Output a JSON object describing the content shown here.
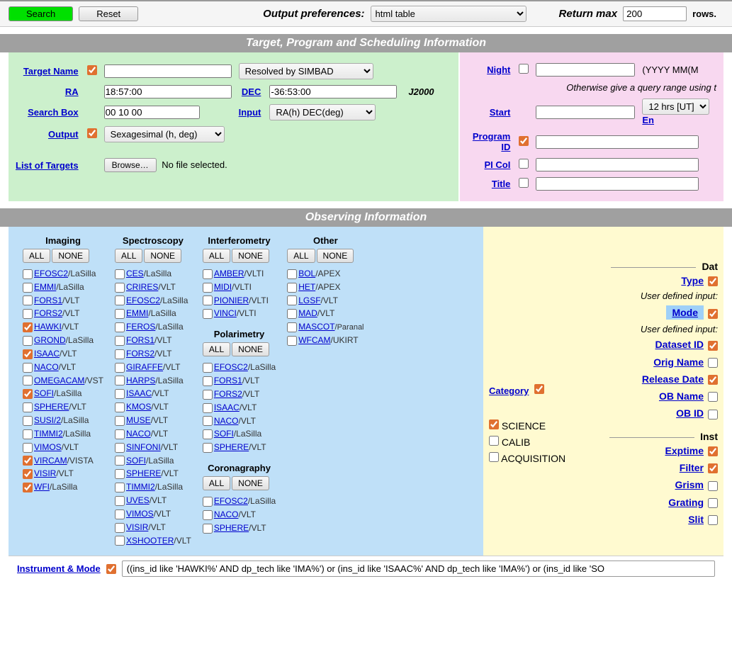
{
  "toolbar": {
    "search": "Search",
    "reset": "Reset",
    "output_pref_label": "Output preferences:",
    "output_pref_value": "html table",
    "return_max_label": "Return max",
    "return_max_value": "200",
    "rows_label": "rows."
  },
  "section1": "Target, Program and Scheduling Information",
  "target": {
    "target_name": "Target Name",
    "resolved_by": "Resolved by SIMBAD",
    "ra_label": "RA",
    "ra_value": "18:57:00",
    "dec_label": "DEC",
    "dec_value": "-36:53:00",
    "j2000": "J2000",
    "search_box": "Search Box",
    "search_box_value": "00 10 00",
    "input_label": "Input",
    "input_value": "RA(h) DEC(deg)",
    "output_label": "Output",
    "output_value": "Sexagesimal (h, deg)",
    "list_of_targets": "List of Targets",
    "browse": "Browse…",
    "no_file": "No file selected."
  },
  "sched": {
    "night": "Night",
    "night_hint": "(YYYY MM(M",
    "otherwise": "Otherwise give a query range using t",
    "start": "Start",
    "start_sel": "12 hrs [UT]",
    "end": "En",
    "program_id": "Program ID",
    "pi_coi": "PI CoI",
    "title": "Title"
  },
  "section2": "Observing Information",
  "inst_groups": {
    "imaging": {
      "title": "Imaging",
      "items": [
        {
          "name": "EFOSC2",
          "obs": "/LaSilla",
          "c": false
        },
        {
          "name": "EMMI",
          "obs": "/LaSilla",
          "c": false
        },
        {
          "name": "FORS1",
          "obs": "/VLT",
          "c": false
        },
        {
          "name": "FORS2",
          "obs": "/VLT",
          "c": false
        },
        {
          "name": "HAWKI",
          "obs": "/VLT",
          "c": true
        },
        {
          "name": "GROND",
          "obs": "/LaSilla",
          "c": false
        },
        {
          "name": "ISAAC",
          "obs": "/VLT",
          "c": true
        },
        {
          "name": "NACO",
          "obs": "/VLT",
          "c": false
        },
        {
          "name": "OMEGACAM",
          "obs": "/VST",
          "c": false
        },
        {
          "name": "SOFI",
          "obs": "/LaSilla",
          "c": true
        },
        {
          "name": "SPHERE",
          "obs": "/VLT",
          "c": false
        },
        {
          "name": "SUSI/2",
          "obs": "/LaSilla",
          "c": false
        },
        {
          "name": "TIMMI2",
          "obs": "/LaSilla",
          "c": false
        },
        {
          "name": "VIMOS",
          "obs": "/VLT",
          "c": false
        },
        {
          "name": "VIRCAM",
          "obs": "/VISTA",
          "c": true
        },
        {
          "name": "VISIR",
          "obs": "/VLT",
          "c": true
        },
        {
          "name": "WFI",
          "obs": "/LaSilla",
          "c": true
        }
      ]
    },
    "spectroscopy": {
      "title": "Spectroscopy",
      "items": [
        {
          "name": "CES",
          "obs": "/LaSilla",
          "c": false
        },
        {
          "name": "CRIRES",
          "obs": "/VLT",
          "c": false
        },
        {
          "name": "EFOSC2",
          "obs": "/LaSilla",
          "c": false
        },
        {
          "name": "EMMI",
          "obs": "/LaSilla",
          "c": false
        },
        {
          "name": "FEROS",
          "obs": "/LaSilla",
          "c": false
        },
        {
          "name": "FORS1",
          "obs": "/VLT",
          "c": false
        },
        {
          "name": "FORS2",
          "obs": "/VLT",
          "c": false
        },
        {
          "name": "GIRAFFE",
          "obs": "/VLT",
          "c": false
        },
        {
          "name": "HARPS",
          "obs": "/LaSilla",
          "c": false
        },
        {
          "name": "ISAAC",
          "obs": "/VLT",
          "c": false
        },
        {
          "name": "KMOS",
          "obs": "/VLT",
          "c": false
        },
        {
          "name": "MUSE",
          "obs": "/VLT",
          "c": false
        },
        {
          "name": "NACO",
          "obs": "/VLT",
          "c": false
        },
        {
          "name": "SINFONI",
          "obs": "/VLT",
          "c": false
        },
        {
          "name": "SOFI",
          "obs": "/LaSilla",
          "c": false
        },
        {
          "name": "SPHERE",
          "obs": "/VLT",
          "c": false
        },
        {
          "name": "TIMMI2",
          "obs": "/LaSilla",
          "c": false
        },
        {
          "name": "UVES",
          "obs": "/VLT",
          "c": false
        },
        {
          "name": "VIMOS",
          "obs": "/VLT",
          "c": false
        },
        {
          "name": "VISIR",
          "obs": "/VLT",
          "c": false
        },
        {
          "name": "XSHOOTER",
          "obs": "/VLT",
          "c": false
        }
      ]
    },
    "interferometry": {
      "title": "Interferometry",
      "items": [
        {
          "name": "AMBER",
          "obs": "/VLTI",
          "c": false
        },
        {
          "name": "MIDI",
          "obs": "/VLTI",
          "c": false
        },
        {
          "name": "PIONIER",
          "obs": "/VLTI",
          "c": false
        },
        {
          "name": "VINCI",
          "obs": "/VLTI",
          "c": false
        }
      ]
    },
    "polarimetry": {
      "title": "Polarimetry",
      "items": [
        {
          "name": "EFOSC2",
          "obs": "/LaSilla",
          "c": false
        },
        {
          "name": "FORS1",
          "obs": "/VLT",
          "c": false
        },
        {
          "name": "FORS2",
          "obs": "/VLT",
          "c": false
        },
        {
          "name": "ISAAC",
          "obs": "/VLT",
          "c": false
        },
        {
          "name": "NACO",
          "obs": "/VLT",
          "c": false
        },
        {
          "name": "SOFI",
          "obs": "/LaSilla",
          "c": false
        },
        {
          "name": "SPHERE",
          "obs": "/VLT",
          "c": false
        }
      ]
    },
    "coronagraphy": {
      "title": "Coronagraphy",
      "items": [
        {
          "name": "EFOSC2",
          "obs": "/LaSilla",
          "c": false
        },
        {
          "name": "NACO",
          "obs": "/VLT",
          "c": false
        },
        {
          "name": "SPHERE",
          "obs": "/VLT",
          "c": false
        }
      ]
    },
    "other": {
      "title": "Other",
      "items": [
        {
          "name": "BOL",
          "obs": "/APEX",
          "c": false
        },
        {
          "name": "HET",
          "obs": "/APEX",
          "c": false
        },
        {
          "name": "LGSF",
          "obs": "/VLT",
          "c": false
        },
        {
          "name": "MAD",
          "obs": "/VLT",
          "c": false
        },
        {
          "name": "MASCOT",
          "obs": "/Paranal",
          "c": false,
          "small": true
        },
        {
          "name": "WFCAM",
          "obs": "/UKIRT",
          "c": false
        }
      ]
    }
  },
  "buttons": {
    "all": "ALL",
    "none": "NONE"
  },
  "category": {
    "label": "Category",
    "items": [
      {
        "label": "SCIENCE",
        "c": true
      },
      {
        "label": "CALIB",
        "c": false
      },
      {
        "label": "ACQUISITION",
        "c": false
      }
    ]
  },
  "right": {
    "dat_header": "Dat",
    "type": "Type",
    "udi": "User defined input:",
    "mode": "Mode",
    "dataset_id": "Dataset ID",
    "orig_name": "Orig Name",
    "release_date": "Release Date",
    "ob_name": "OB Name",
    "ob_id": "OB ID",
    "inst_header": "Inst",
    "exptime": "Exptime",
    "filter": "Filter",
    "grism": "Grism",
    "grating": "Grating",
    "slit": "Slit"
  },
  "instrument_mode": {
    "label": "Instrument & Mode",
    "value": "((ins_id like 'HAWKI%' AND dp_tech like 'IMA%') or (ins_id like 'ISAAC%' AND dp_tech like 'IMA%') or (ins_id like 'SO"
  }
}
